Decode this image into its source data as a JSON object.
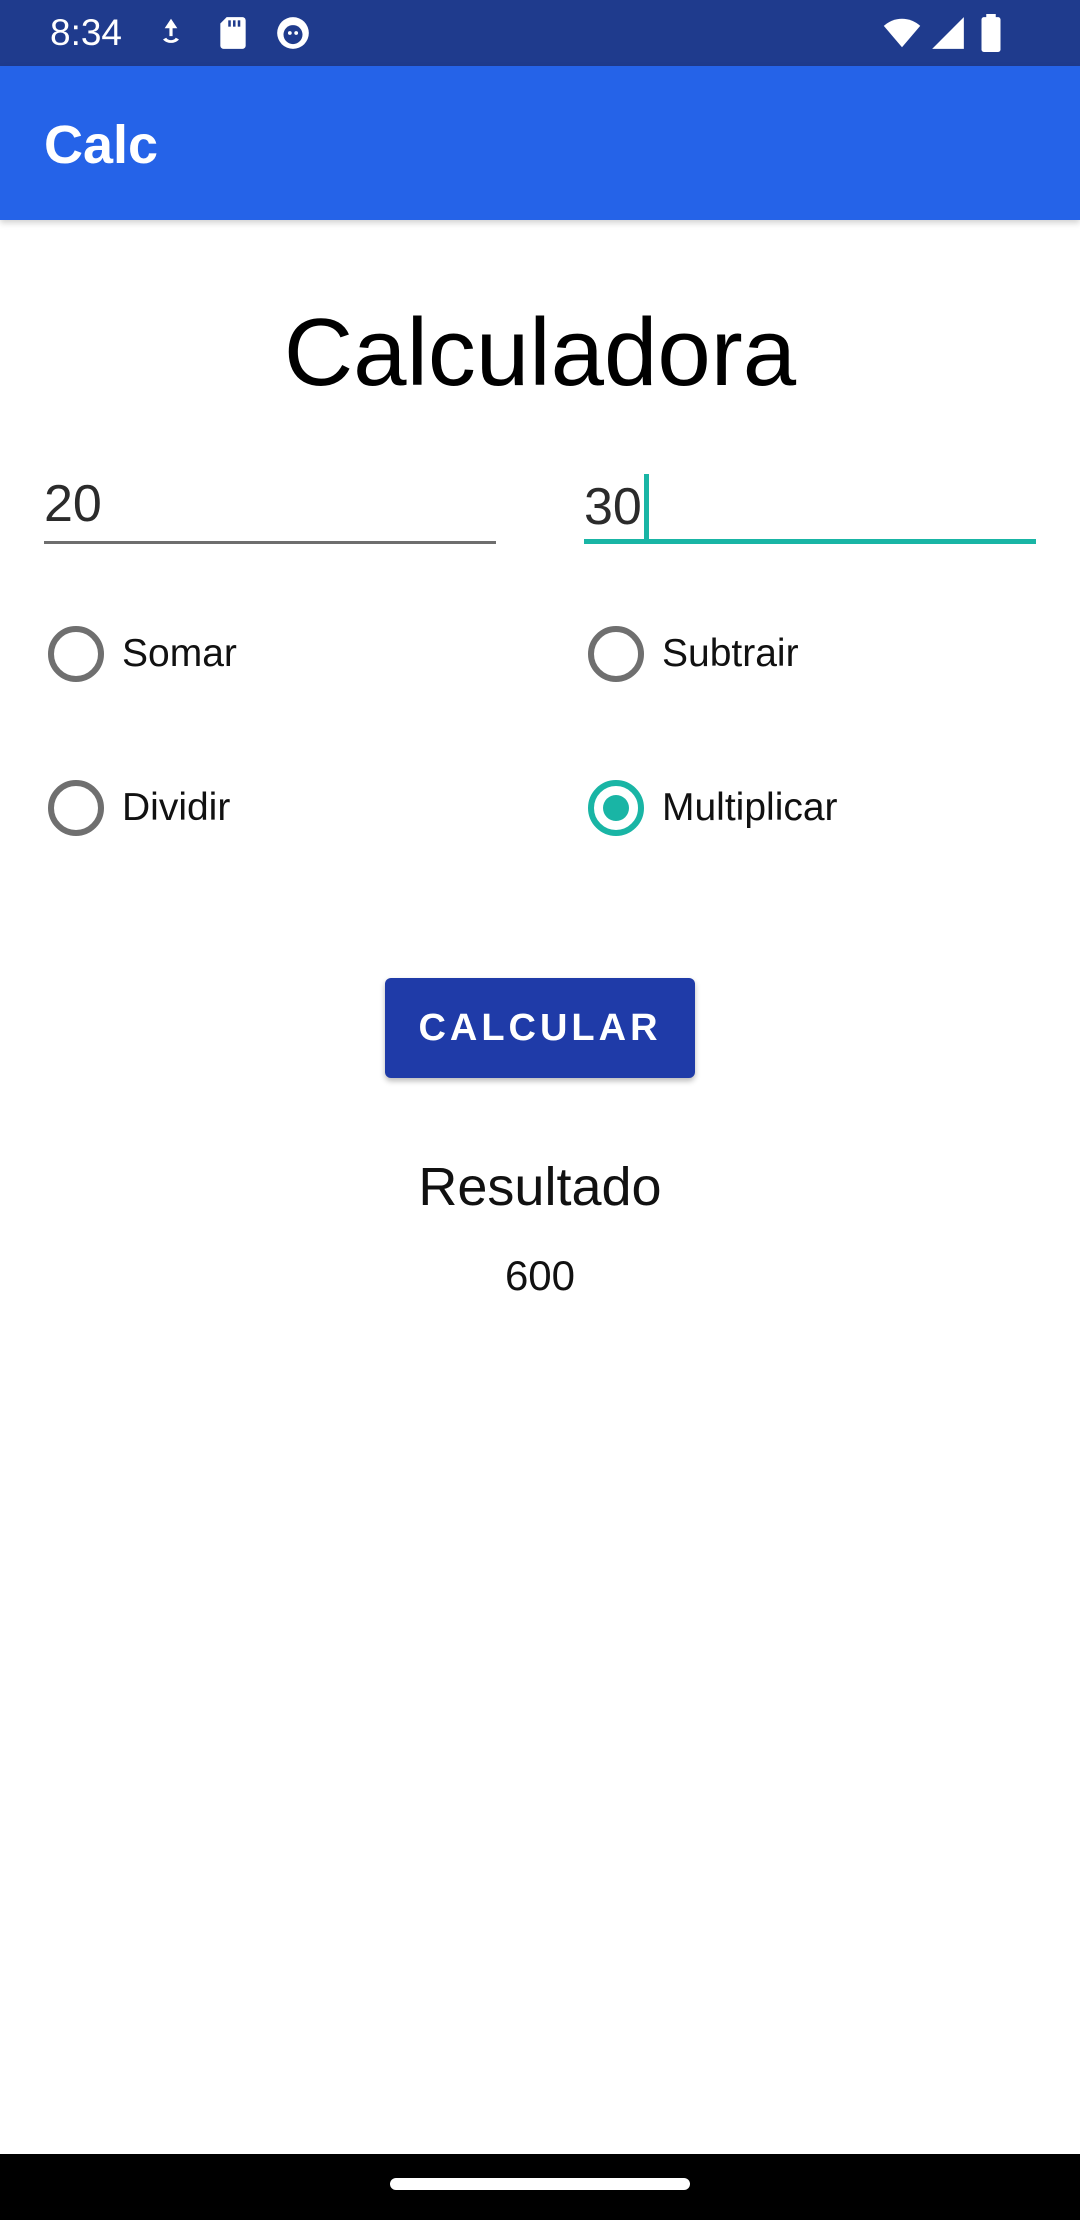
{
  "status_bar": {
    "time": "8:34",
    "left_icons": [
      "gesture-icon",
      "sd-card-icon",
      "cat-face-icon"
    ],
    "right_icons": [
      "wifi-icon",
      "signal-icon",
      "battery-icon"
    ]
  },
  "app_bar": {
    "title": "Calc"
  },
  "main": {
    "heading": "Calculadora",
    "input_first": "20",
    "input_second": "30",
    "operations": [
      {
        "label": "Somar",
        "checked": false
      },
      {
        "label": "Subtrair",
        "checked": false
      },
      {
        "label": "Dividir",
        "checked": false
      },
      {
        "label": "Multiplicar",
        "checked": true
      }
    ],
    "button_label": "CALCULAR",
    "result_title": "Resultado",
    "result_value": "600"
  },
  "colors": {
    "status_bar": "#1f3b8d",
    "app_bar": "#2563e8",
    "accent": "#19b5a5",
    "button": "#1f3ba8"
  }
}
